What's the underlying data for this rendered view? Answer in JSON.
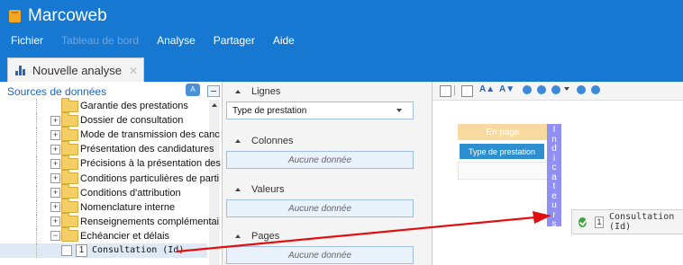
{
  "app": {
    "title": "Marcoweb"
  },
  "menu": [
    {
      "label": "Fichier",
      "disabled": false
    },
    {
      "label": "Tableau de bord",
      "disabled": true
    },
    {
      "label": "Analyse",
      "disabled": false
    },
    {
      "label": "Partager",
      "disabled": false
    },
    {
      "label": "Aide",
      "disabled": false
    }
  ],
  "tab": {
    "label": "Nouvelle analyse",
    "close": "✕"
  },
  "sources": {
    "title": "Sources de données",
    "badge": "A",
    "items": [
      {
        "label": "Garantie des prestations"
      },
      {
        "label": "Dossier de consultation",
        "expander": "+"
      },
      {
        "label": "Mode de transmission des canc",
        "expander": "+"
      },
      {
        "label": "Présentation des candidatures",
        "expander": "+"
      },
      {
        "label": "Précisions à la présentation des",
        "expander": "+"
      },
      {
        "label": "Conditions particulières de parti",
        "expander": "+"
      },
      {
        "label": "Conditions d'attribution",
        "expander": "+"
      },
      {
        "label": "Nomenclature interne",
        "expander": "+"
      },
      {
        "label": "Renseignements complémentai",
        "expander": "+"
      },
      {
        "label": "Echéancier et délais",
        "expander": "−"
      }
    ],
    "field": {
      "icon": "1",
      "label": "Consultation (Id)"
    }
  },
  "areas": {
    "rows": {
      "label": "Lignes",
      "value": "Type de prestation"
    },
    "columns": {
      "label": "Colonnes",
      "empty": "Aucune donnée"
    },
    "values": {
      "label": "Valeurs",
      "empty": "Aucune donnée"
    },
    "pages": {
      "label": "Pages",
      "empty": "Aucune donnée"
    }
  },
  "preview": {
    "toolbar": {
      "font_up": "A▲",
      "font_down": "A▼"
    },
    "en_page": "En page",
    "row_field": "Type de prestation",
    "indicators": "Indicateurs"
  },
  "drag": {
    "icon": "1",
    "label": "Consultation (Id)",
    "status": "ok"
  },
  "colors": {
    "header": "#1778d2",
    "indicators": "#8f8ff4",
    "row_field": "#2e8fd0",
    "en_page": "#f8d9a0",
    "arrow": "#e01010"
  }
}
